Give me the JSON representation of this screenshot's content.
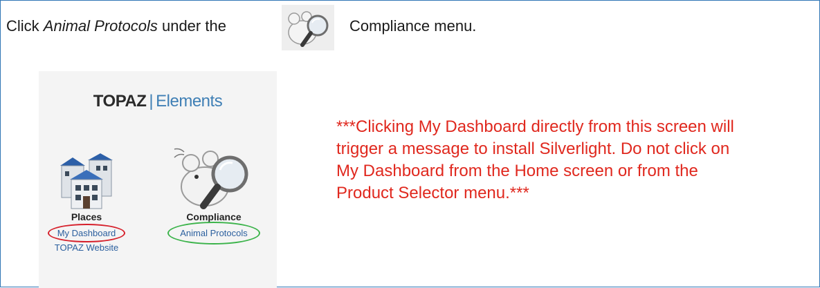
{
  "instruction": {
    "prefix": "Click ",
    "emphasis": "Animal Protocols",
    "middle": " under the",
    "suffix": "Compliance menu."
  },
  "panel": {
    "brand_primary": "TOPAZ",
    "brand_separator": "|",
    "brand_secondary": "Elements",
    "places": {
      "title": "Places",
      "link_dashboard": "My Dashboard",
      "link_website": "TOPAZ Website"
    },
    "compliance": {
      "title": "Compliance",
      "link_protocols": "Animal Protocols"
    }
  },
  "warning": {
    "line1": "***Clicking My Dashboard directly from this screen will",
    "line2": "trigger a message to install Silverlight.  Do not click on",
    "line3": "My Dashboard from the Home screen or from the",
    "line4": "Product Selector menu.***"
  },
  "colors": {
    "frame_border": "#2f75b5",
    "warning_text": "#e0281e",
    "link": "#2b5f9e",
    "highlight_red": "#d6202b",
    "highlight_green": "#3bb34a"
  }
}
